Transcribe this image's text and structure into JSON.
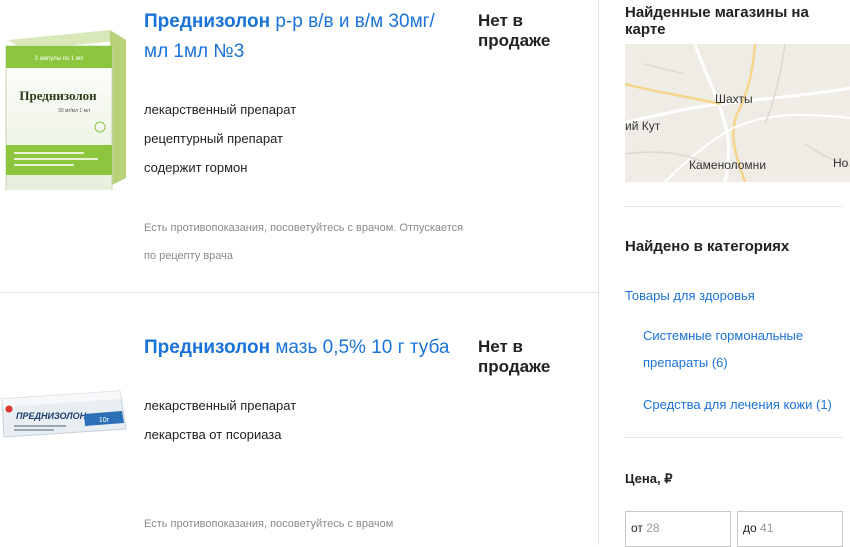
{
  "products": [
    {
      "title_name": "Преднизолон",
      "title_rest": " р-р в/в и в/м 30мг/мл 1мл №3",
      "availability": "Нет в продаже",
      "properties": [
        "лекарственный препарат",
        "рецептурный препарат",
        "содержит гормон"
      ],
      "warning": "Есть противопоказания, посоветуйтесь с врачом. Отпускается по рецепту врача",
      "thumb": {
        "brand": "Преднизолон",
        "dose": "30 мг/мл 1 мл",
        "top_text": "3 ампулы по 1 мл",
        "colors": {
          "stripe": "#8cc63f",
          "box": "#f4f8ec",
          "text": "#2d3b1a"
        }
      }
    },
    {
      "title_name": "Преднизолон",
      "title_rest": " мазь 0,5% 10 г туба",
      "availability": "Нет в продаже",
      "properties": [
        "лекарственный препарат",
        "лекарства от псориаза"
      ],
      "warning": "Есть противопоказания, посоветуйтесь с врачом",
      "thumb": {
        "brand": "ПРЕДНИЗОЛОН",
        "dose": "10г",
        "colors": {
          "tube": "#e9eef2",
          "band": "#2b6fb6",
          "text": "#1c3f6e"
        }
      }
    }
  ],
  "sidebar": {
    "map_heading": "Найденные магазины на карте",
    "map_labels": {
      "city": "Шахты",
      "left": "ий Кут",
      "bottom": "Каменоломни",
      "right": "Но"
    },
    "categories_heading": "Найдено в категориях",
    "category_root": "Товары для здоровья",
    "subcategory_1_line1": "Системные гормональные",
    "subcategory_1_line2": "препараты (6)",
    "subcategory_2": "Средства для лечения кожи (1)",
    "price_heading": "Цена, ₽",
    "price_from_prefix": "от",
    "price_from_placeholder": "28",
    "price_to_prefix": "до",
    "price_to_placeholder": "41"
  },
  "colors": {
    "link": "#1a73d9",
    "divider": "#e6e6e6",
    "muted": "#8a8a8a"
  }
}
